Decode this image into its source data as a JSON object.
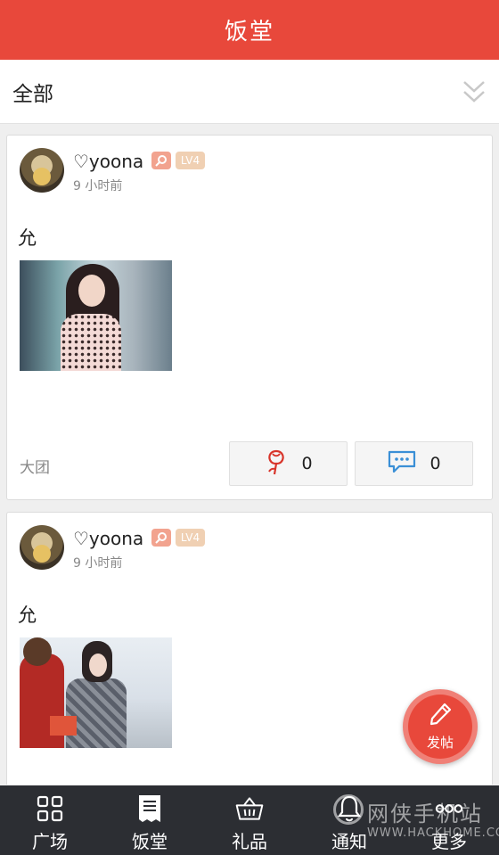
{
  "header": {
    "title": "饭堂"
  },
  "filter": {
    "label": "全部",
    "expand_icon": "double-chevron-down-icon"
  },
  "posts": [
    {
      "username": "♡yoona",
      "level": "LV4",
      "time": "9 小时前",
      "text": "允",
      "group": "大团",
      "likes": "0",
      "comments": "0"
    },
    {
      "username": "♡yoona",
      "level": "LV4",
      "time": "9 小时前",
      "text": "允"
    }
  ],
  "fab": {
    "label": "发帖",
    "icon": "pen-icon"
  },
  "nav": [
    {
      "label": "广场",
      "icon": "grid-icon"
    },
    {
      "label": "饭堂",
      "icon": "document-icon"
    },
    {
      "label": "礼品",
      "icon": "basket-icon"
    },
    {
      "label": "通知",
      "icon": "bell-icon"
    },
    {
      "label": "更多",
      "icon": "more-icon"
    }
  ],
  "watermark": {
    "text_cn": "网侠手机站",
    "text_en": "WWW.HACKHOME.COM"
  },
  "colors": {
    "brand_red": "#e8483b",
    "nav_bg": "#2c2e33",
    "badge_pink": "#f2a38f",
    "badge_tan": "#f0d0b3"
  }
}
